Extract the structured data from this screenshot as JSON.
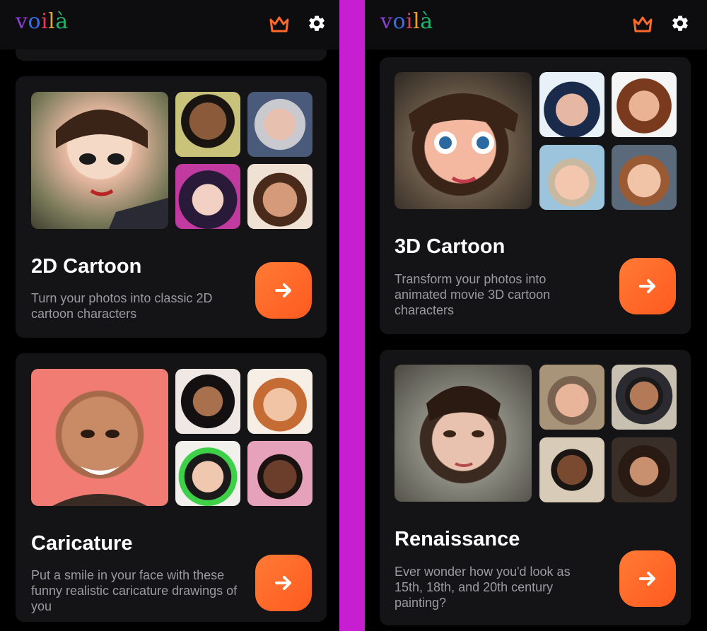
{
  "app": {
    "logo_letters": [
      "v",
      "o",
      "i",
      "l",
      "à"
    ],
    "brand_colors": [
      "#8a3fd1",
      "#3b6fe8",
      "#e23a5a",
      "#f0a020",
      "#1eb46a"
    ],
    "accent": "#ff6a2a",
    "premium_icon": "crown-icon",
    "settings_icon": "gear-icon",
    "action_icon": "arrow-right-icon"
  },
  "left": {
    "cards": [
      {
        "title": "2D Cartoon",
        "description": "Turn your photos into classic 2D cartoon characters"
      },
      {
        "title": "Caricature",
        "description": "Put a smile in your face with these funny realistic caricature drawings of you"
      }
    ]
  },
  "right": {
    "cards": [
      {
        "title": "3D Cartoon",
        "description": "Transform your photos into animated movie 3D cartoon characters"
      },
      {
        "title": "Renaissance",
        "description": "Ever wonder how you'd look as 15th, 18th, and 20th century painting?"
      }
    ]
  }
}
